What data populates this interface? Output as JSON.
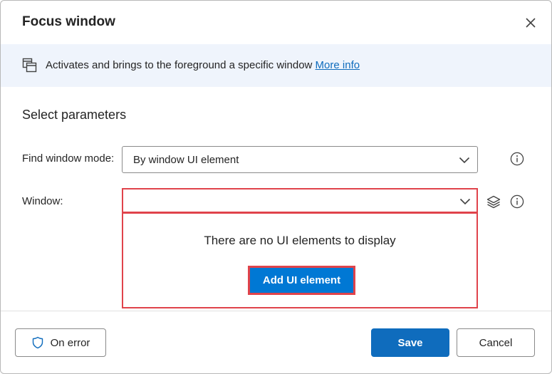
{
  "dialog": {
    "title": "Focus window",
    "close_icon": "close-icon"
  },
  "info": {
    "icon": "window-stack-icon",
    "text": "Activates and brings to the foreground a specific window ",
    "link": "More info"
  },
  "params": {
    "section_title": "Select parameters",
    "find_mode": {
      "label": "Find window mode:",
      "value": "By window UI element",
      "help_icon": "info-circle-icon"
    },
    "window": {
      "label": "Window:",
      "value": "",
      "layers_icon": "layers-icon",
      "help_icon": "info-circle-icon"
    },
    "dropdown": {
      "empty_message": "There are no UI elements to display",
      "add_button": "Add UI element"
    }
  },
  "footer": {
    "on_error": "On error",
    "save": "Save",
    "cancel": "Cancel"
  },
  "colors": {
    "accent": "#0f6cbd",
    "highlight": "#e0434b",
    "banner": "#eff4fc"
  }
}
